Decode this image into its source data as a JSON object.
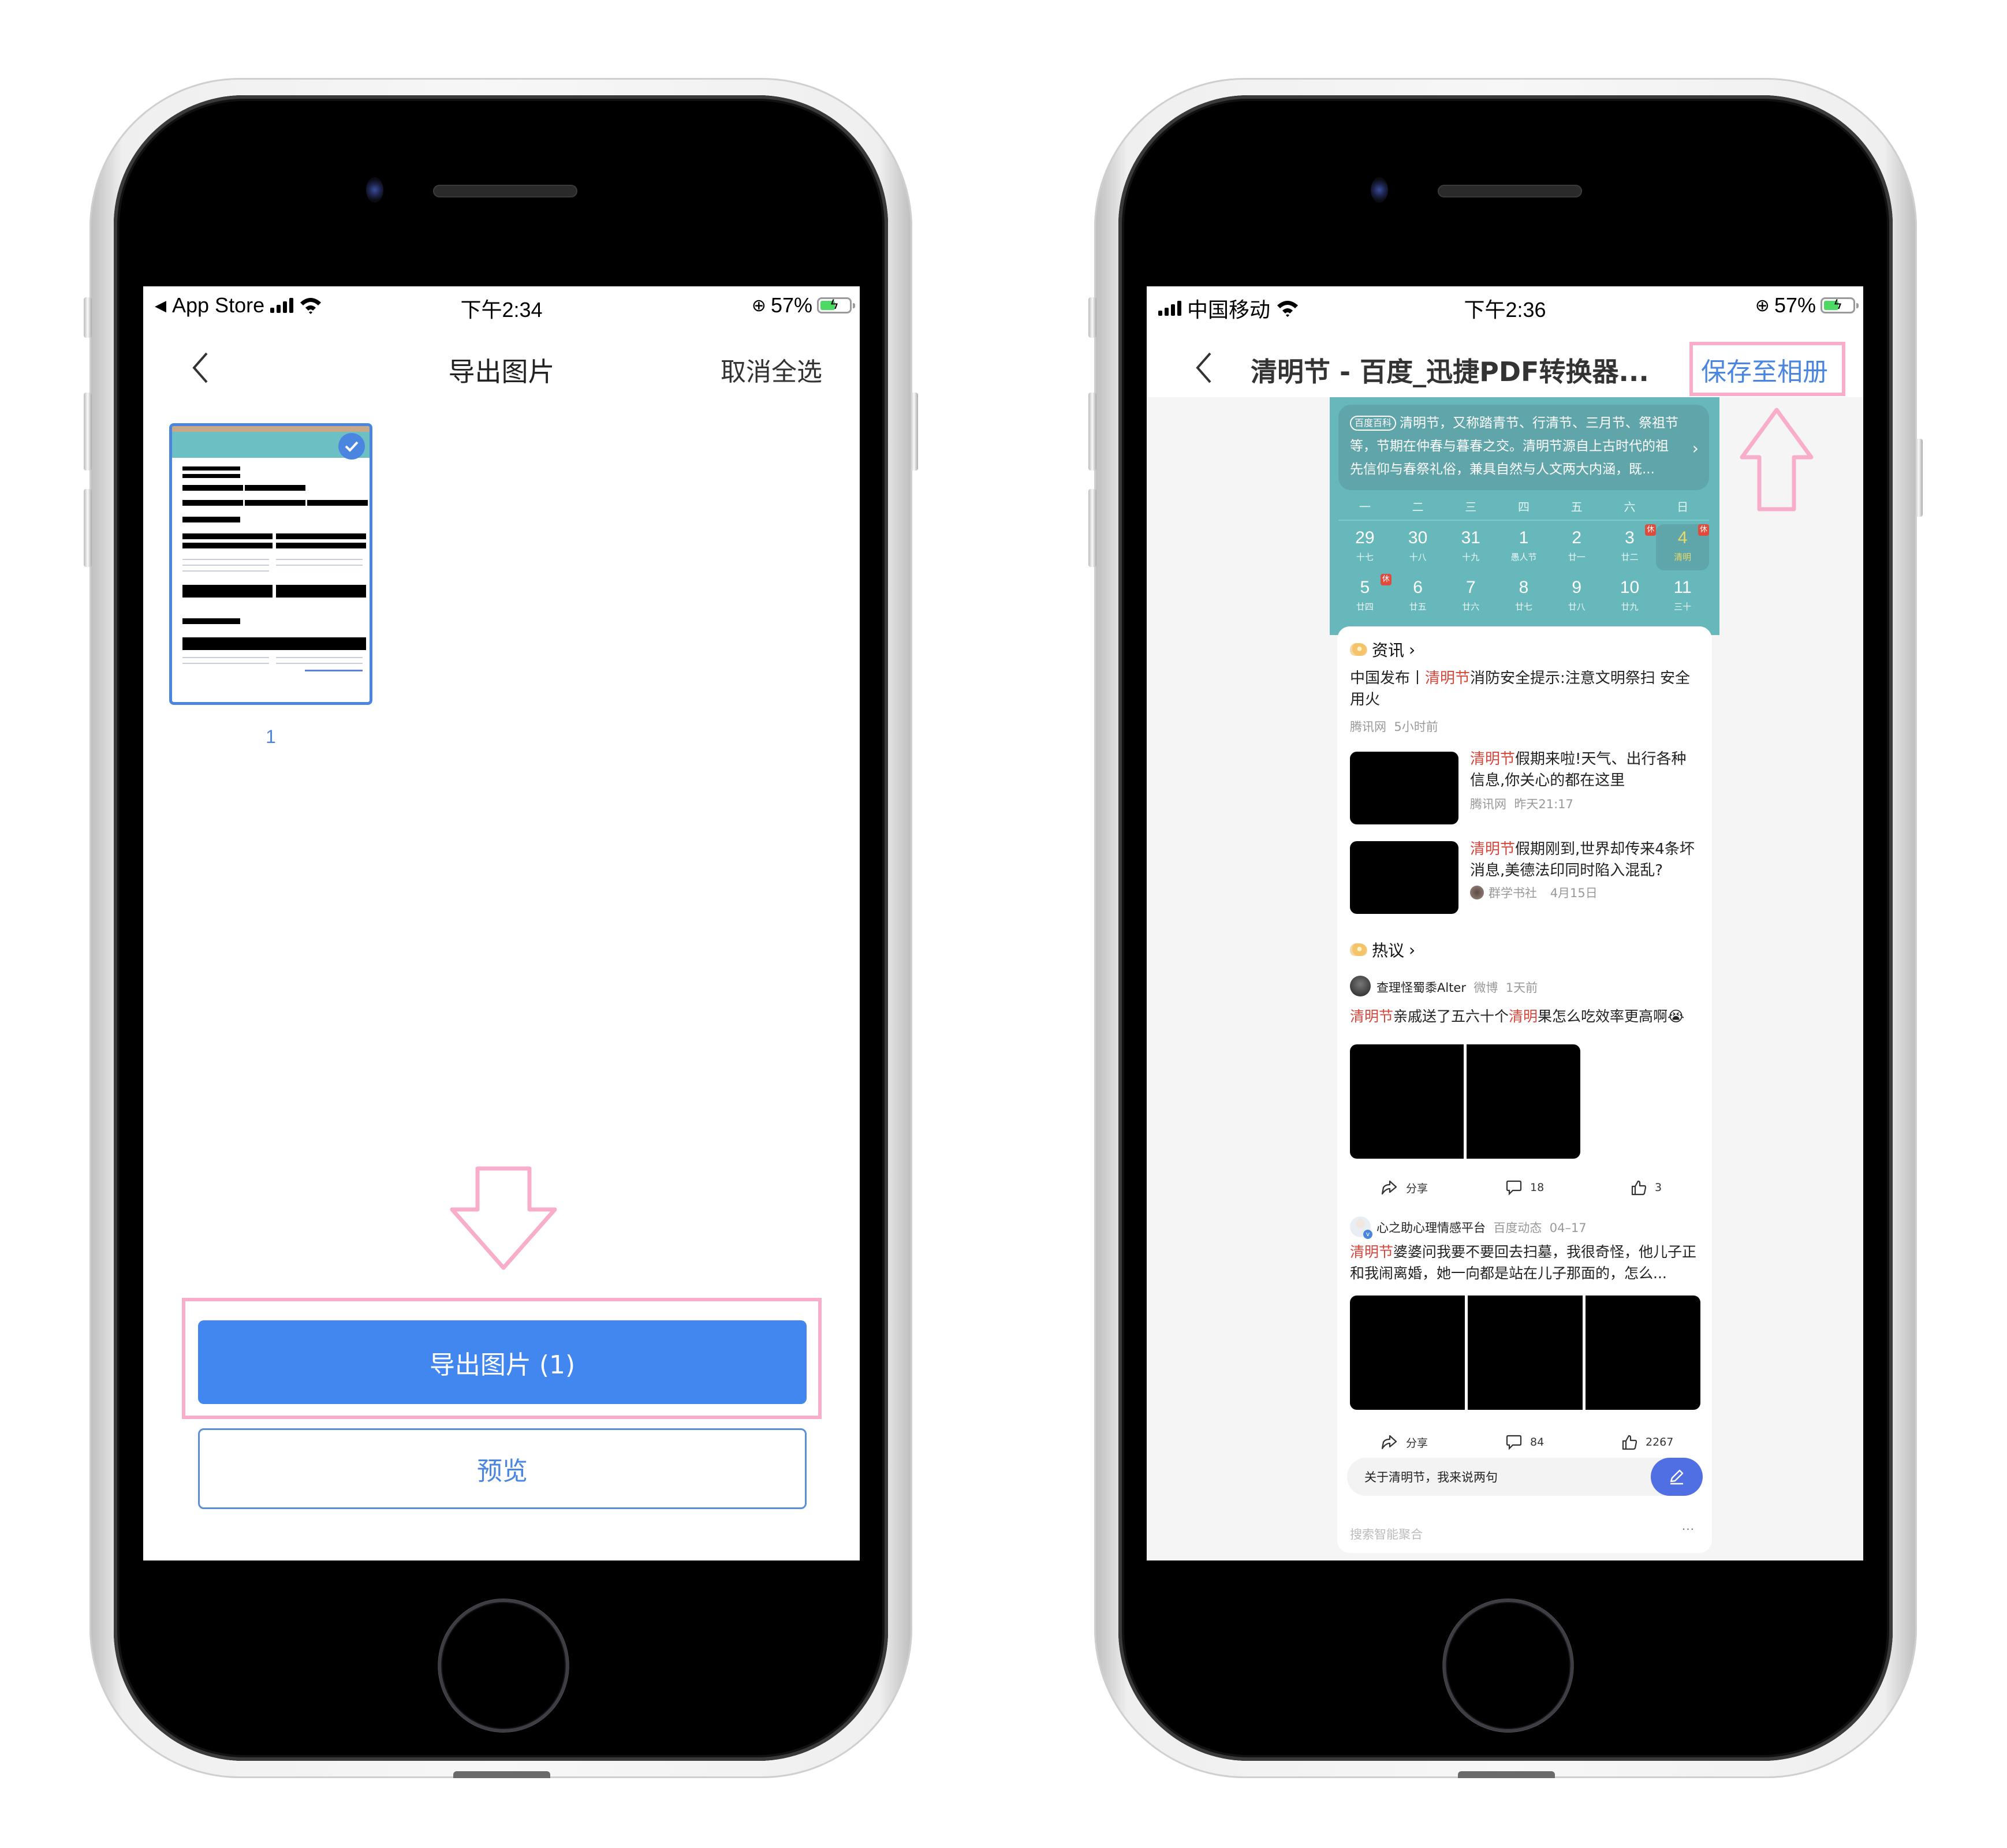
{
  "left_phone": {
    "status_bar": {
      "back_app": "App Store",
      "time": "下午2:34",
      "battery": "57%"
    },
    "nav": {
      "title": "导出图片",
      "action": "取消全选"
    },
    "pages": [
      {
        "number": "1",
        "selected": true
      }
    ],
    "buttons": {
      "export": "导出图片 (1)",
      "preview": "预览"
    },
    "annotation": {
      "arrow": "down",
      "highlight": "export-button",
      "color": "#f8aecb"
    },
    "colors": {
      "accent": "#4287f0"
    }
  },
  "right_phone": {
    "status_bar": {
      "carrier": "中国移动",
      "time": "下午2:36",
      "battery": "57%"
    },
    "nav": {
      "title": "清明节 - 百度_迅捷PDF转换器...",
      "action": "保存至相册"
    },
    "annotation": {
      "arrow": "up",
      "highlight": "save-to-album-button",
      "color": "#f8aecb"
    },
    "baike": {
      "tag": "百度百科",
      "text": "清明节，又称踏青节、行清节、三月节、祭祖节等，节期在仲春与暮春之交。清明节源自上古时代的祖先信仰与春祭礼俗，兼具自然与人文两大内涵，既..."
    },
    "calendar": {
      "weekdays": [
        "一",
        "二",
        "三",
        "四",
        "五",
        "六",
        "日"
      ],
      "rest_label": "休",
      "weeks": [
        [
          {
            "day": "29",
            "lunar": "十七"
          },
          {
            "day": "30",
            "lunar": "十八"
          },
          {
            "day": "31",
            "lunar": "十九"
          },
          {
            "day": "1",
            "lunar": "愚人节"
          },
          {
            "day": "2",
            "lunar": "廿一"
          },
          {
            "day": "3",
            "lunar": "廿二",
            "rest": true
          },
          {
            "day": "4",
            "lunar": "清明",
            "rest": true,
            "today": true
          }
        ],
        [
          {
            "day": "5",
            "lunar": "廿四",
            "rest": true
          },
          {
            "day": "6",
            "lunar": "廿五"
          },
          {
            "day": "7",
            "lunar": "廿六"
          },
          {
            "day": "8",
            "lunar": "廿七"
          },
          {
            "day": "9",
            "lunar": "廿八"
          },
          {
            "day": "10",
            "lunar": "廿九"
          },
          {
            "day": "11",
            "lunar": "三十"
          }
        ]
      ]
    },
    "news": {
      "title": "资讯",
      "items": [
        {
          "prefix": "中国发布丨",
          "highlight": "清明节",
          "rest": "消防安全提示:注意文明祭扫 安全用火",
          "source": "腾讯网",
          "time": "5小时前"
        },
        {
          "highlight": "清明节",
          "rest": "假期来啦!天气、出行各种信息,你关心的都在这里",
          "source": "腾讯网",
          "time": "昨天21:17"
        },
        {
          "highlight": "清明节",
          "rest": "假期刚到,世界却传来4条坏消息,美德法印同时陷入混乱?",
          "source": "群学书社",
          "time": "4月15日"
        }
      ]
    },
    "discussion": {
      "title": "热议",
      "posts": [
        {
          "author": "查理怪蜀黍Alter",
          "platform": "微博",
          "time": "1天前",
          "parts": [
            {
              "t": "清明节",
              "hl": true
            },
            {
              "t": "亲戚送了五六十个"
            },
            {
              "t": "清明",
              "hl": true
            },
            {
              "t": "果怎么吃效率更高啊😭"
            }
          ],
          "share": "分享",
          "comments": "18",
          "likes": "3"
        },
        {
          "author": "心之助心理情感平台",
          "platform": "百度动态",
          "time": "04–17",
          "parts": [
            {
              "t": "清明节",
              "hl": true
            },
            {
              "t": "婆婆问我要不要回去扫墓，我很奇怪，他儿子正和我闹离婚，她一向都是站在儿子那面的，怎么..."
            }
          ],
          "share": "分享",
          "comments": "84",
          "likes": "2267"
        }
      ]
    },
    "comment_input": {
      "placeholder": "关于清明节，我来说两句"
    },
    "footer": {
      "label": "搜索智能聚合",
      "more": "···"
    },
    "colors": {
      "teal": "#66b8bb",
      "highlight_red": "#d9453a",
      "link_blue": "#4a86e0",
      "pen_button": "#4f6fe3"
    }
  }
}
